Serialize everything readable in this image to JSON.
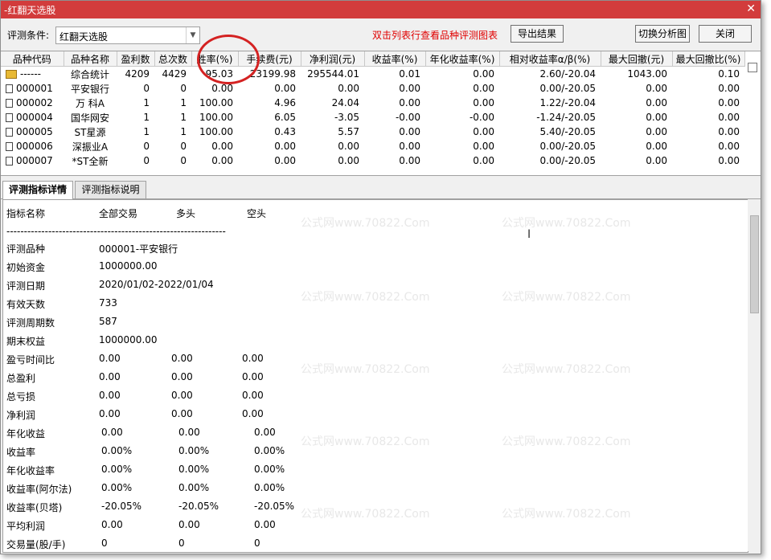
{
  "window": {
    "title": "-红翻天选股",
    "close_glyph": "✕"
  },
  "toolbar": {
    "condition_label": "评测条件:",
    "condition_value": "红翻天选股",
    "hint": "双击列表行查看品种评测图表",
    "export_label": "导出结果",
    "switch_label": "切换分析图",
    "close_label": "关闭"
  },
  "grid": {
    "columns": [
      "品种代码",
      "品种名称",
      "盈利数",
      "总次数",
      "胜率(%)",
      "手续费(元)",
      "净利润(元)",
      "收益率(%)",
      "年化收益率(%)",
      "相对收益率α/β(%)",
      "最大回撤(元)",
      "最大回撤比(%)"
    ],
    "rows": [
      {
        "code": "------",
        "name": "综合统计",
        "win": "4209",
        "total": "4429",
        "rate": "95.03",
        "fee": "23199.98",
        "profit": "295544.01",
        "ret": "0.01",
        "annual": "0.00",
        "alpha": "2.60/-20.04",
        "dd": "1043.00",
        "ddr": "0.10",
        "icon": "folder-icon"
      },
      {
        "code": "000001",
        "name": "平安银行",
        "win": "0",
        "total": "0",
        "rate": "0.00",
        "fee": "0.00",
        "profit": "0.00",
        "ret": "0.00",
        "annual": "0.00",
        "alpha": "0.00/-20.05",
        "dd": "0.00",
        "ddr": "0.00",
        "icon": "document-icon"
      },
      {
        "code": "000002",
        "name": "万 科A",
        "win": "1",
        "total": "1",
        "rate": "100.00",
        "fee": "4.96",
        "profit": "24.04",
        "ret": "0.00",
        "annual": "0.00",
        "alpha": "1.22/-20.04",
        "dd": "0.00",
        "ddr": "0.00",
        "icon": "document-icon"
      },
      {
        "code": "000004",
        "name": "国华网安",
        "win": "1",
        "total": "1",
        "rate": "100.00",
        "fee": "6.05",
        "profit": "-3.05",
        "ret": "-0.00",
        "annual": "-0.00",
        "alpha": "-1.24/-20.05",
        "dd": "0.00",
        "ddr": "0.00",
        "icon": "document-icon"
      },
      {
        "code": "000005",
        "name": "ST星源",
        "win": "1",
        "total": "1",
        "rate": "100.00",
        "fee": "0.43",
        "profit": "5.57",
        "ret": "0.00",
        "annual": "0.00",
        "alpha": "5.40/-20.05",
        "dd": "0.00",
        "ddr": "0.00",
        "icon": "document-icon"
      },
      {
        "code": "000006",
        "name": "深振业A",
        "win": "0",
        "total": "0",
        "rate": "0.00",
        "fee": "0.00",
        "profit": "0.00",
        "ret": "0.00",
        "annual": "0.00",
        "alpha": "0.00/-20.05",
        "dd": "0.00",
        "ddr": "0.00",
        "icon": "document-icon"
      },
      {
        "code": "000007",
        "name": "*ST全新",
        "win": "0",
        "total": "0",
        "rate": "0.00",
        "fee": "0.00",
        "profit": "0.00",
        "ret": "0.00",
        "annual": "0.00",
        "alpha": "0.00/-20.05",
        "dd": "0.00",
        "ddr": "0.00",
        "icon": "document-icon"
      }
    ]
  },
  "tabs": [
    "评测指标详情",
    "评测指标说明"
  ],
  "detail": {
    "header": [
      "指标名称",
      "全部交易",
      "多头",
      "空头"
    ],
    "separator": "---------------------------------------------------------------",
    "rows": [
      {
        "label": "评测品种",
        "v": [
          "000001-平安银行"
        ]
      },
      {
        "label": "初始资金",
        "v": [
          "1000000.00"
        ]
      },
      {
        "label": "评测日期",
        "v": [
          "2020/01/02-2022/01/04"
        ]
      },
      {
        "label": "有效天数",
        "v": [
          "733"
        ]
      },
      {
        "label": "评测周期数",
        "v": [
          "587"
        ]
      },
      {
        "label": "期末权益",
        "v": [
          "1000000.00"
        ]
      },
      {
        "label": "盈亏时间比",
        "v": [
          "0.00",
          "0.00",
          "0.00"
        ]
      },
      {
        "label": "总盈利",
        "v": [
          "0.00",
          "0.00",
          "0.00"
        ]
      },
      {
        "label": "总亏损",
        "v": [
          "0.00",
          "0.00",
          "0.00"
        ]
      },
      {
        "label": "净利润",
        "v": [
          "0.00",
          "0.00",
          "0.00"
        ]
      },
      {
        "label": "年化收益",
        "v": [
          "0.00",
          "0.00",
          "0.00"
        ]
      },
      {
        "label": "收益率",
        "v": [
          "0.00%",
          "0.00%",
          "0.00%"
        ]
      },
      {
        "label": "年化收益率",
        "v": [
          "0.00%",
          "0.00%",
          "0.00%"
        ]
      },
      {
        "label": "收益率(阿尔法)",
        "v": [
          "0.00%",
          "0.00%",
          "0.00%"
        ]
      },
      {
        "label": "收益率(贝塔)",
        "v": [
          "-20.05%",
          "-20.05%",
          "-20.05%"
        ]
      },
      {
        "label": "平均利润",
        "v": [
          "0.00",
          "0.00",
          "0.00"
        ]
      },
      {
        "label": "交易量(股/手)",
        "v": [
          "0",
          "0",
          "0"
        ]
      }
    ]
  },
  "watermark": "公式网www.70822.Com",
  "colors": {
    "titlebar": "#d23c3c",
    "hint": "#e00000",
    "annotation_circle": "#d42222"
  }
}
